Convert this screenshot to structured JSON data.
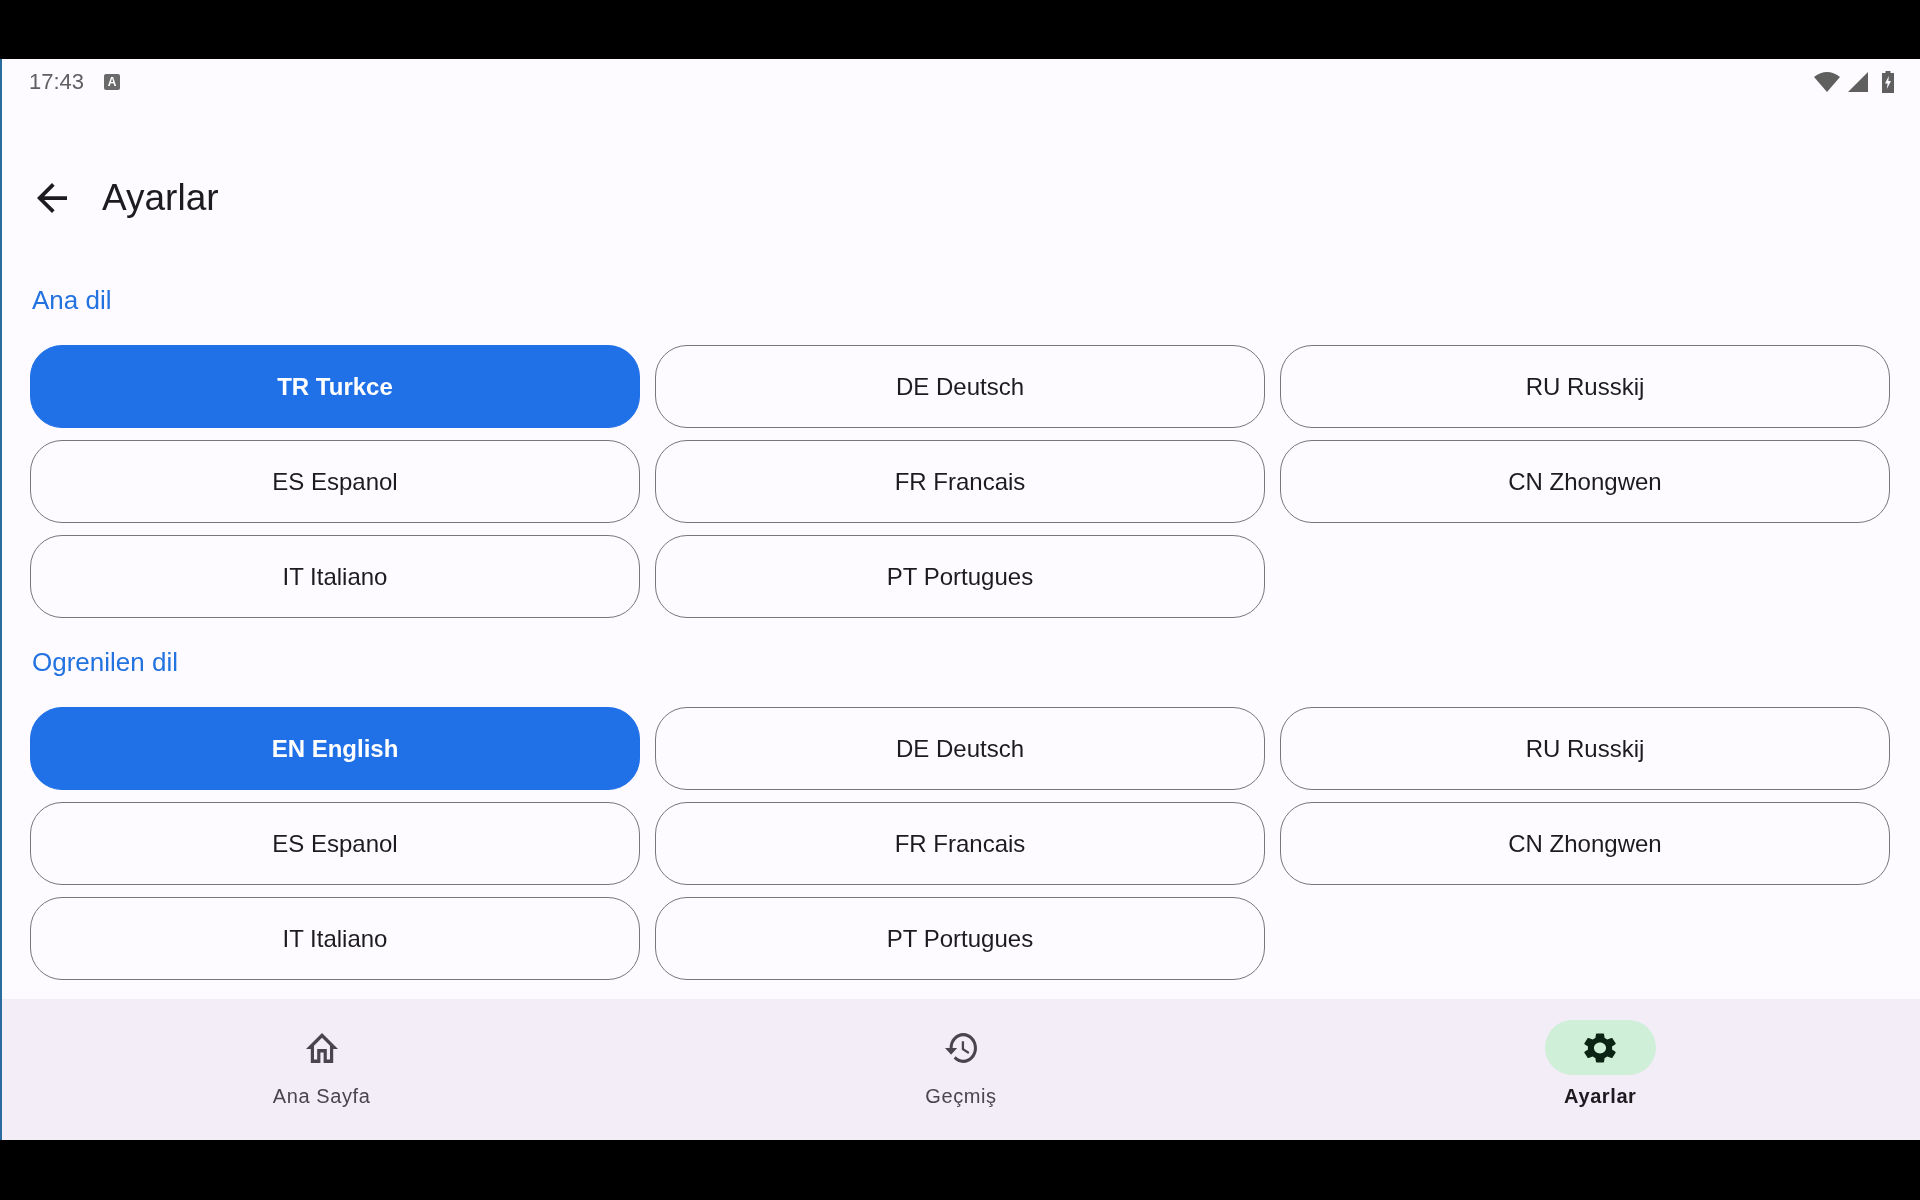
{
  "status_bar": {
    "time": "17:43",
    "notification_glyph": "A"
  },
  "top_bar": {
    "title": "Ayarlar"
  },
  "sections": [
    {
      "title": "Ana dil",
      "options": [
        {
          "label": "TR Turkce",
          "selected": true
        },
        {
          "label": "DE Deutsch",
          "selected": false
        },
        {
          "label": "RU Russkij",
          "selected": false
        },
        {
          "label": "ES Espanol",
          "selected": false
        },
        {
          "label": "FR Francais",
          "selected": false
        },
        {
          "label": "CN Zhongwen",
          "selected": false
        },
        {
          "label": "IT Italiano",
          "selected": false
        },
        {
          "label": "PT Portugues",
          "selected": false
        }
      ]
    },
    {
      "title": "Ogrenilen dil",
      "options": [
        {
          "label": "EN English",
          "selected": true
        },
        {
          "label": "DE Deutsch",
          "selected": false
        },
        {
          "label": "RU Russkij",
          "selected": false
        },
        {
          "label": "ES Espanol",
          "selected": false
        },
        {
          "label": "FR Francais",
          "selected": false
        },
        {
          "label": "CN Zhongwen",
          "selected": false
        },
        {
          "label": "IT Italiano",
          "selected": false
        },
        {
          "label": "PT Portugues",
          "selected": false
        }
      ]
    }
  ],
  "bottom_nav": {
    "items": [
      {
        "label": "Ana Sayfa",
        "kind": "home",
        "selected": false
      },
      {
        "label": "Geçmiş",
        "kind": "history",
        "selected": false
      },
      {
        "label": "Ayarlar",
        "kind": "settings",
        "selected": true
      }
    ]
  }
}
